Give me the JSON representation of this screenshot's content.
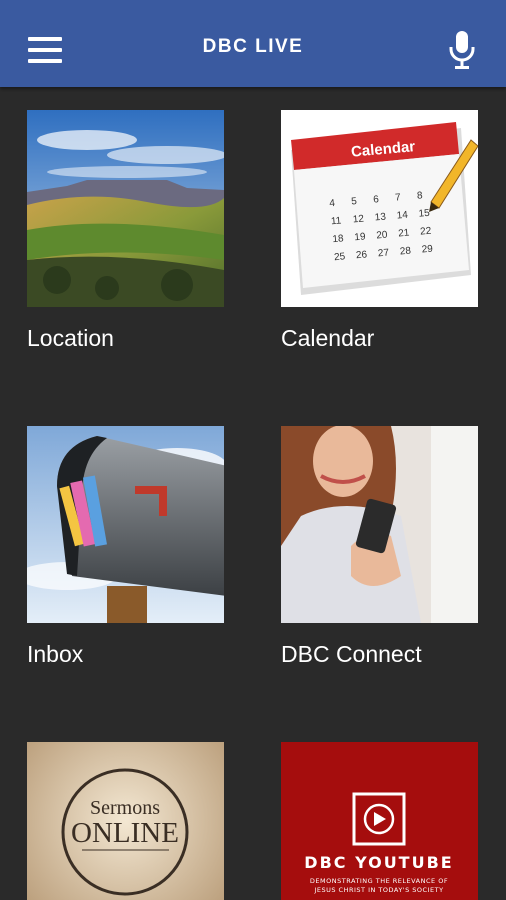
{
  "header": {
    "title": "DBC LIVE",
    "menu_icon": "hamburger-menu-icon",
    "mic_icon": "microphone-icon",
    "bg_color": "#3a5aa0"
  },
  "tiles": [
    {
      "label": "Location",
      "icon": "landscape-photo"
    },
    {
      "label": "Calendar",
      "icon": "calendar-photo",
      "image_text": "Calendar"
    },
    {
      "label": "Inbox",
      "icon": "mailbox-photo"
    },
    {
      "label": "DBC Connect",
      "icon": "phone-user-photo"
    },
    {
      "label": "",
      "icon": "sermons-online-photo",
      "image_text_1": "Sermons",
      "image_text_2": "ONLINE"
    },
    {
      "label": "",
      "icon": "dbc-youtube-photo",
      "image_text_1": "DBC YOUTUBE",
      "image_text_2": "DEMONSTRATING THE RELEVANCE OF",
      "image_text_3": "JESUS CHRIST IN TODAY'S SOCIETY"
    }
  ]
}
